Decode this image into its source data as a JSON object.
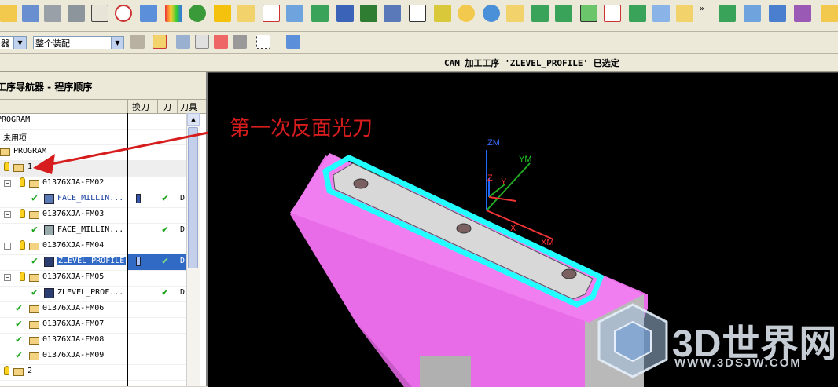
{
  "status": {
    "message": "CAM 加工工序 'ZLEVEL_PROFILE' 已选定"
  },
  "toolbar2": {
    "filter_combo": "器",
    "assembly_combo": "整个装配"
  },
  "navigator": {
    "title": "工序导航器 - 程序顺序",
    "columns": {
      "tool_change": "换刀",
      "path": "刀",
      "tool": "刀具"
    },
    "rows": [
      {
        "label": "PROGRAM",
        "level": 0
      },
      {
        "label": "未用项",
        "level": 0
      },
      {
        "label": "PROGRAM",
        "level": 0
      },
      {
        "label": "1",
        "level": 1
      },
      {
        "label": "01376XJA-FM02",
        "level": 2
      },
      {
        "label": "FACE_MILLIN...",
        "level": 3,
        "path_col": "D"
      },
      {
        "label": "01376XJA-FM03",
        "level": 2
      },
      {
        "label": "FACE_MILLIN...",
        "level": 3,
        "path_col": "D"
      },
      {
        "label": "01376XJA-FM04",
        "level": 2
      },
      {
        "label": "ZLEVEL_PROFILE",
        "level": 3,
        "path_col": "D"
      },
      {
        "label": "01376XJA-FM05",
        "level": 2
      },
      {
        "label": "ZLEVEL_PROF...",
        "level": 3,
        "path_col": "D"
      },
      {
        "label": "01376XJA-FM06",
        "level": 2
      },
      {
        "label": "01376XJA-FM07",
        "level": 2
      },
      {
        "label": "01376XJA-FM08",
        "level": 2
      },
      {
        "label": "01376XJA-FM09",
        "level": 2
      },
      {
        "label": "2",
        "level": 1
      }
    ]
  },
  "viewport": {
    "annotation": "第一次反面光刀",
    "axes": {
      "zm": "ZM",
      "ym": "YM",
      "z": "Z",
      "y": "Y",
      "x": "X",
      "xm": "XM"
    },
    "watermark_text": "3D世界网",
    "watermark_url": "WWW.3DSJW.COM"
  },
  "colors": {
    "part_pink": "#f07ef0",
    "toolpath_cyan": "#21ffff",
    "annotation_red": "#d61c1c",
    "selection_blue": "#316ac5"
  }
}
